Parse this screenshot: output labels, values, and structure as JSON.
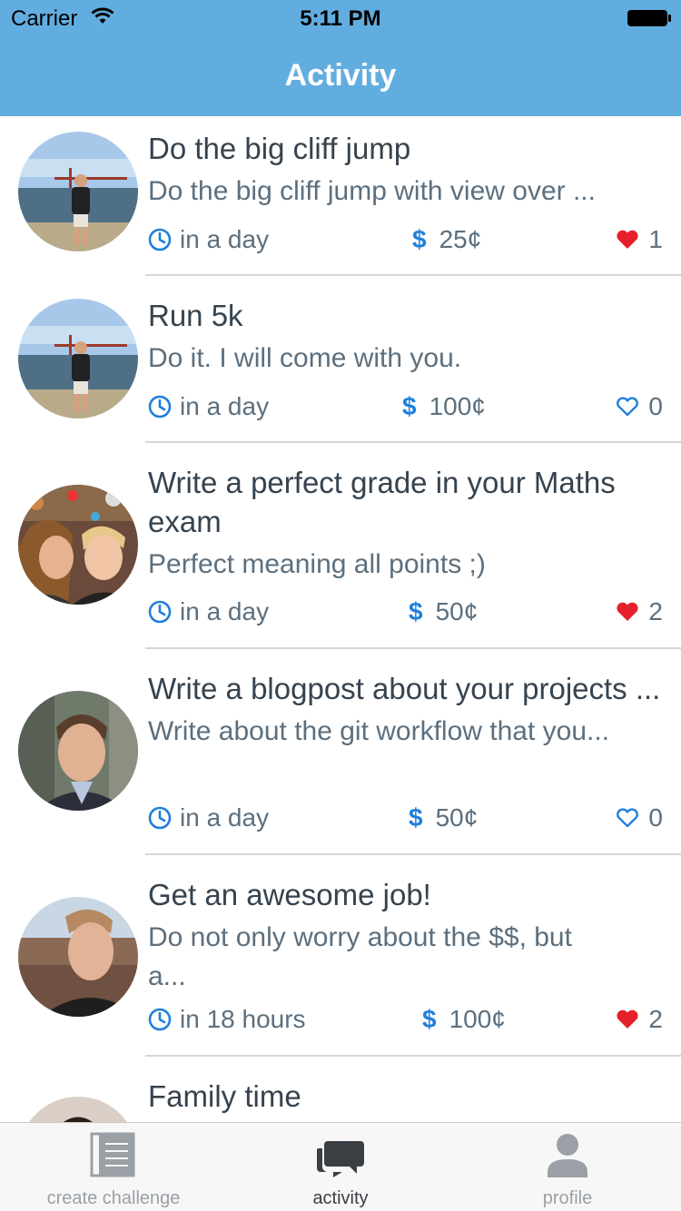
{
  "status_bar": {
    "carrier": "Carrier",
    "time": "5:11 PM"
  },
  "header": {
    "title": "Activity"
  },
  "items": [
    {
      "title": "Do the big cliff jump",
      "description": "Do the big cliff jump with view over ...",
      "time": "in a day",
      "price": "25¢",
      "likes": "1",
      "liked": true,
      "avatar": "bridge-photo"
    },
    {
      "title": "Run 5k",
      "description": "Do it. I will come with you.",
      "time": "in a day",
      "price": "100¢",
      "likes": "0",
      "liked": false,
      "avatar": "bridge-photo"
    },
    {
      "title": "Write a perfect grade in your Maths exam",
      "description": "Perfect meaning all points ;)",
      "time": "in a day",
      "price": "50¢",
      "likes": "2",
      "liked": true,
      "avatar": "couple-photo"
    },
    {
      "title": "Write a blogpost about your projects ...",
      "description": "Write about the git workflow that you...",
      "time": "in a day",
      "price": "50¢",
      "likes": "0",
      "liked": false,
      "avatar": "portrait-photo"
    },
    {
      "title": "Get an awesome job!",
      "description": "Do not only worry about the $$, but\na...",
      "time": "in 18 hours",
      "price": "100¢",
      "likes": "2",
      "liked": true,
      "avatar": "canyon-selfie-photo"
    },
    {
      "title": "Family time",
      "description": "",
      "time": "",
      "price": "",
      "likes": "",
      "liked": false,
      "avatar": "woman-photo"
    }
  ],
  "tabbar": {
    "tabs": [
      {
        "label": "create challenge",
        "icon": "notepad-icon",
        "active": false
      },
      {
        "label": "activity",
        "icon": "chat-bubbles-icon",
        "active": true
      },
      {
        "label": "profile",
        "icon": "person-icon",
        "active": false
      }
    ]
  },
  "colors": {
    "header": "#62addf",
    "accent": "#1f7fdc",
    "heart": "#e5202a",
    "text": "#36434f",
    "subtext": "#5c6f7e"
  }
}
